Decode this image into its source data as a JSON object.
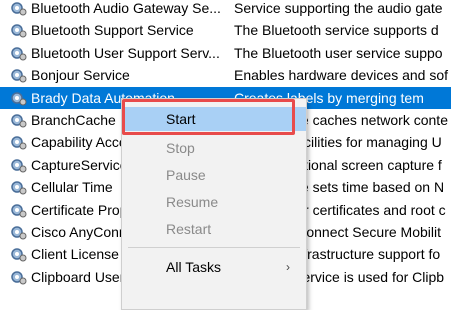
{
  "services": [
    {
      "name": "Bluetooth Audio Gateway Se...",
      "description": "Service supporting the audio gate"
    },
    {
      "name": "Bluetooth Support Service",
      "description": "The Bluetooth service supports d"
    },
    {
      "name": "Bluetooth User Support Serv...",
      "description": "The Bluetooth user service suppo"
    },
    {
      "name": "Bonjour Service",
      "description": "Enables hardware devices and sof"
    },
    {
      "name": "Brady Data Automation",
      "description": "Creates labels by merging tem"
    },
    {
      "name": "BranchCache",
      "description": "This service caches network conte"
    },
    {
      "name": "Capability Access Manager",
      "description": "Provides facilities for managing U"
    },
    {
      "name": "CaptureService",
      "description": "Enables optional screen capture f"
    },
    {
      "name": "Cellular Time",
      "description": "This service sets time based on N"
    },
    {
      "name": "Certificate Propagation",
      "description": "Copies user certificates and root c"
    },
    {
      "name": "Cisco AnyConnect",
      "description": "Cisco AnyConnect Secure Mobilit"
    },
    {
      "name": "Client License Service",
      "description": "Provides infrastructure support fo"
    },
    {
      "name": "Clipboard User Service",
      "description": "This user service is used for Clipb"
    }
  ],
  "context_menu": {
    "items": [
      {
        "label": "Start",
        "enabled": true
      },
      {
        "label": "Stop",
        "enabled": false
      },
      {
        "label": "Pause",
        "enabled": false
      },
      {
        "label": "Resume",
        "enabled": false
      },
      {
        "label": "Restart",
        "enabled": false
      },
      {
        "label": "All Tasks",
        "enabled": true,
        "submenu_arrow": "›"
      }
    ]
  },
  "colors": {
    "selection": "#0078d7",
    "menu_highlight": "#a9d0f5",
    "focus_outline": "#e84b4b"
  }
}
